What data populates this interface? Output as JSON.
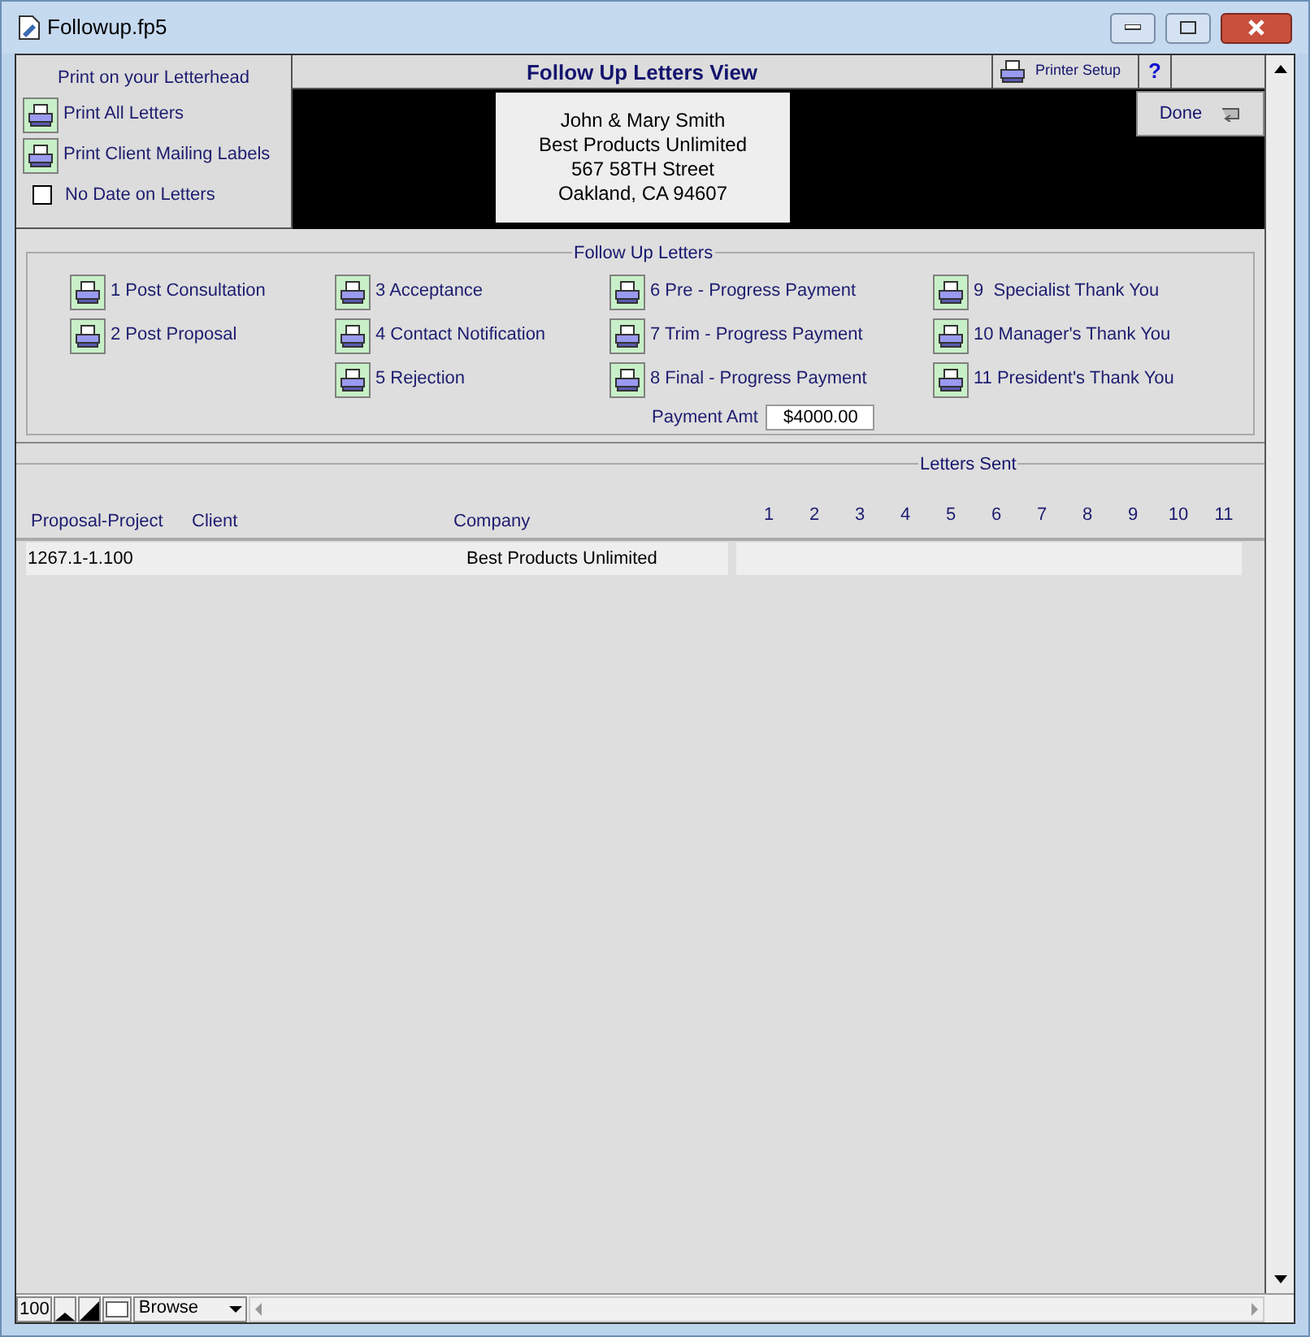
{
  "window": {
    "title": "Followup.fp5"
  },
  "left_panel": {
    "heading": "Print on your Letterhead",
    "buttons": [
      "Print All Letters",
      "Print Client Mailing Labels"
    ],
    "checkbox": {
      "label": "No Date on Letters",
      "checked": false
    }
  },
  "header": {
    "title": "Follow Up Letters View",
    "printer_setup": "Printer Setup",
    "help": "?",
    "done": "Done"
  },
  "address": [
    "John & Mary Smith",
    "Best Products Unlimited",
    "567 58TH Street",
    "Oakland, CA 94607"
  ],
  "follow_up": {
    "legend": "Follow Up Letters",
    "columns": [
      [
        "1 Post Consultation",
        "2 Post Proposal"
      ],
      [
        "3 Acceptance",
        "4 Contact Notification",
        "5 Rejection"
      ],
      [
        "6 Pre - Progress Payment",
        "7 Trim - Progress Payment",
        "8 Final - Progress Payment"
      ],
      [
        "9  Specialist Thank You",
        "10 Manager's Thank You",
        "11 President's Thank You"
      ]
    ],
    "payment": {
      "label": "Payment Amt",
      "value": "$4000.00"
    }
  },
  "letters_sent": {
    "legend": "Letters Sent",
    "columns": [
      "Proposal-Project",
      "Client",
      "Company"
    ],
    "number_columns": [
      "1",
      "2",
      "3",
      "4",
      "5",
      "6",
      "7",
      "8",
      "9",
      "10",
      "11"
    ],
    "rows": [
      {
        "proposal_project": "1267.1-1.100",
        "company": "Best Products Unlimited"
      }
    ]
  },
  "status_bar": {
    "zoom": "100",
    "mode": "Browse"
  }
}
